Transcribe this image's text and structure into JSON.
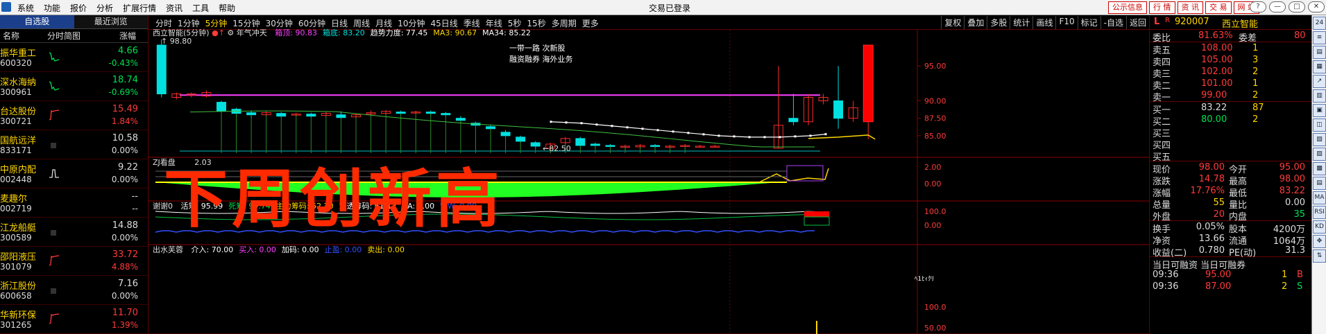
{
  "menubar": {
    "items": [
      "系统",
      "功能",
      "报价",
      "分析",
      "扩展行情",
      "资讯",
      "工具",
      "帮助"
    ],
    "title": "交易已登录",
    "right_buttons": [
      "公示信息",
      "行 情",
      "资 讯",
      "交 易",
      "网 站"
    ],
    "window_controls": [
      "?",
      "—",
      "□",
      "✕"
    ]
  },
  "watchlist": {
    "tabs": [
      "自选股",
      "最近浏览"
    ],
    "headers": [
      "名称",
      "分时简图",
      "涨幅"
    ],
    "rows": [
      {
        "name": "振华重工",
        "code": "600320",
        "price": "4.66",
        "pct": "-0.43%",
        "dir": "dn"
      },
      {
        "name": "深水海纳",
        "code": "300961",
        "price": "18.74",
        "pct": "-0.69%",
        "dir": "dn"
      },
      {
        "name": "台达股份",
        "code": "300721",
        "price": "15.49",
        "pct": "1.84%",
        "dir": "up"
      },
      {
        "name": "国航远洋",
        "code": "833171",
        "price": "10.58",
        "pct": "0.00%",
        "dir": "eq"
      },
      {
        "name": "中原内配",
        "code": "002448",
        "price": "9.22",
        "pct": "0.00%",
        "dir": "eq"
      },
      {
        "name": "麦趣尔",
        "code": "002719",
        "price": "--",
        "pct": "--",
        "dir": "eq"
      },
      {
        "name": "江龙船艇",
        "code": "300589",
        "price": "14.88",
        "pct": "0.00%",
        "dir": "eq"
      },
      {
        "name": "邵阳液压",
        "code": "301079",
        "price": "33.72",
        "pct": "4.88%",
        "dir": "up"
      },
      {
        "name": "浙江股份",
        "code": "600658",
        "price": "7.16",
        "pct": "0.00%",
        "dir": "eq"
      },
      {
        "name": "华新环保",
        "code": "301265",
        "price": "11.70",
        "pct": "1.39%",
        "dir": "up"
      }
    ]
  },
  "toolbar": {
    "periods": [
      "分时",
      "1分钟",
      "5分钟",
      "15分钟",
      "30分钟",
      "60分钟",
      "日线",
      "周线",
      "月线",
      "10分钟",
      "45日线",
      "季线",
      "年线",
      "5秒",
      "15秒",
      "多周期",
      "更多"
    ],
    "selected_period": "5分钟",
    "tools": [
      "复权",
      "叠加",
      "多股",
      "统计",
      "画线",
      "F10",
      "标记",
      "-自选",
      "返回"
    ]
  },
  "main_chart": {
    "header": "西立智能(5分钟)",
    "indicator_name": "年气冲天",
    "items": [
      {
        "label": "箱顶: 90.83",
        "color": "#ff40ff"
      },
      {
        "label": "箱底: 83.20",
        "color": "#00e0e0"
      },
      {
        "label": "趋势力度: 77.45",
        "color": "#ffffff"
      },
      {
        "label": "MA3: 90.67",
        "color": "#ffd700"
      },
      {
        "label": "MA34: 85.22",
        "color": "#ffffff"
      }
    ],
    "top_price": "98.80",
    "low_price": "82.50",
    "info_lines": [
      "一带一路 次新股",
      "融资融券 海外业务"
    ],
    "y_ticks": [
      "95.00",
      "90.00",
      "87.50",
      "85.00"
    ],
    "overlay_text": "下周创新高"
  },
  "sub1": {
    "name": "ZJ看盘",
    "items": [
      "2.03"
    ],
    "y_ticks": [
      "2.00",
      "0.00"
    ]
  },
  "sub2": {
    "name": "谢谢0",
    "items": [
      {
        "label": "活筹: 95.99",
        "color": "#ffffff"
      },
      {
        "label": "死筹: 99.74",
        "color": "#00e050"
      },
      {
        "label": "主力筹码: 52.70",
        "color": "#ffd700"
      },
      {
        "label": "穿透筹码: 61.12",
        "color": "#ffffff"
      },
      {
        "label": "AA: 1.00",
        "color": "#ffffff"
      },
      {
        "label": "WW: 0.00",
        "color": "#3050ff"
      }
    ],
    "y_ticks": [
      "100.0",
      "0.00"
    ]
  },
  "sub3": {
    "name": "出水芙蓉",
    "items": [
      {
        "label": "介入: 70.00",
        "color": "#ffffff"
      },
      {
        "label": "买入: 0.00",
        "color": "#ff40ff"
      },
      {
        "label": "加码: 0.00",
        "color": "#ffffff"
      },
      {
        "label": "止盈: 0.00",
        "color": "#3050ff"
      },
      {
        "label": "卖出: 0.00",
        "color": "#ffd700"
      }
    ],
    "mark": "ﾍ1ﾋｨｸﾘ",
    "y_ticks": [
      "100.0",
      "50.00"
    ]
  },
  "quote": {
    "code": "920007",
    "name": "西立智能",
    "tag": "L",
    "webi": [
      "委比",
      "81.63%",
      "委差",
      "80"
    ],
    "asks": [
      {
        "label": "卖五",
        "price": "108.00",
        "vol": "1"
      },
      {
        "label": "卖四",
        "price": "105.00",
        "vol": "3"
      },
      {
        "label": "卖三",
        "price": "102.00",
        "vol": "2"
      },
      {
        "label": "卖二",
        "price": "101.00",
        "vol": "1"
      },
      {
        "label": "卖一",
        "price": "99.00",
        "vol": "2"
      }
    ],
    "bids": [
      {
        "label": "买一",
        "price": "83.22",
        "vol": "87"
      },
      {
        "label": "买二",
        "price": "80.00",
        "vol": "2"
      },
      {
        "label": "买三",
        "price": "",
        "vol": ""
      },
      {
        "label": "买四",
        "price": "",
        "vol": ""
      },
      {
        "label": "买五",
        "price": "",
        "vol": ""
      }
    ],
    "stats": [
      [
        "现价",
        "98.00",
        "今开",
        "95.00"
      ],
      [
        "涨跌",
        "14.78",
        "最高",
        "98.00"
      ],
      [
        "涨幅",
        "17.76%",
        "最低",
        "83.22"
      ],
      [
        "总量",
        "55",
        "量比",
        "0.00"
      ],
      [
        "外盘",
        "20",
        "内盘",
        "35"
      ]
    ],
    "stats2": [
      [
        "换手",
        "0.05%",
        "股本",
        "4200万"
      ],
      [
        "净资",
        "13.66",
        "流通",
        "1064万"
      ],
      [
        "收益(二)",
        "0.780",
        "PE(动)",
        "31.3"
      ]
    ],
    "margin_header": "当日可融资 当日可融券",
    "ticks": [
      {
        "time": "09:36",
        "price": "95.00",
        "vol": "1",
        "side": "B"
      },
      {
        "time": "09:36",
        "price": "87.00",
        "vol": "2",
        "side": "S"
      }
    ]
  },
  "iconbar": [
    "24",
    "≡",
    "▤",
    "▦",
    "↗",
    "▥",
    "▣",
    "◫",
    "▧",
    "▨",
    "▩",
    "▤",
    "MA",
    "RSI",
    "KD",
    "✥",
    "⇅"
  ],
  "chart_data": {
    "type": "candlestick",
    "title": "西立智能(5分钟)",
    "candles_approx": [
      {
        "o": 98.0,
        "c": 91.0,
        "h": 98.8,
        "l": 90.5
      },
      {
        "o": 90.5,
        "c": 91.0,
        "h": 91.2,
        "l": 90.2
      },
      {
        "o": 90.8,
        "c": 91.0,
        "h": 91.2,
        "l": 90.5
      },
      {
        "o": 90.7,
        "c": 91.2,
        "h": 91.5,
        "l": 90.5
      },
      {
        "o": 89.8,
        "c": 88.5,
        "h": 90.0,
        "l": 88.0
      },
      {
        "o": 88.8,
        "c": 88.2,
        "h": 89.0,
        "l": 87.8
      },
      {
        "o": 88.3,
        "c": 88.0,
        "h": 88.6,
        "l": 87.5
      },
      {
        "o": 88.0,
        "c": 88.3,
        "h": 88.5,
        "l": 87.8
      },
      {
        "o": 88.2,
        "c": 87.8,
        "h": 88.4,
        "l": 87.6
      },
      {
        "o": 88.0,
        "c": 88.1,
        "h": 88.3,
        "l": 87.8
      },
      {
        "o": 88.1,
        "c": 87.8,
        "h": 88.3,
        "l": 87.6
      },
      {
        "o": 87.9,
        "c": 88.2,
        "h": 88.5,
        "l": 87.7
      },
      {
        "o": 88.0,
        "c": 87.6,
        "h": 88.5,
        "l": 87.4
      },
      {
        "o": 87.7,
        "c": 88.0,
        "h": 88.2,
        "l": 87.5
      },
      {
        "o": 88.1,
        "c": 88.3,
        "h": 88.6,
        "l": 87.9
      },
      {
        "o": 88.2,
        "c": 88.5,
        "h": 88.7,
        "l": 88.0
      },
      {
        "o": 88.4,
        "c": 88.2,
        "h": 88.6,
        "l": 88.0
      },
      {
        "o": 88.3,
        "c": 88.4,
        "h": 88.6,
        "l": 88.1
      },
      {
        "o": 88.4,
        "c": 88.2,
        "h": 88.6,
        "l": 88.0
      },
      {
        "o": 88.2,
        "c": 88.0,
        "h": 88.4,
        "l": 87.8
      },
      {
        "o": 87.5,
        "c": 87.2,
        "h": 87.8,
        "l": 87.0
      },
      {
        "o": 86.8,
        "c": 86.5,
        "h": 87.0,
        "l": 86.3
      },
      {
        "o": 86.3,
        "c": 86.0,
        "h": 86.5,
        "l": 85.8
      },
      {
        "o": 85.5,
        "c": 85.0,
        "h": 85.8,
        "l": 84.8
      },
      {
        "o": 84.8,
        "c": 84.2,
        "h": 85.0,
        "l": 84.0
      },
      {
        "o": 84.0,
        "c": 83.5,
        "h": 84.2,
        "l": 83.2
      },
      {
        "o": 83.2,
        "c": 83.8,
        "h": 84.0,
        "l": 82.5
      },
      {
        "o": 84.0,
        "c": 84.6,
        "h": 84.8,
        "l": 83.8
      },
      {
        "o": 84.6,
        "c": 83.6,
        "h": 84.8,
        "l": 83.5
      },
      {
        "o": 83.8,
        "c": 83.6,
        "h": 84.0,
        "l": 83.4
      },
      {
        "o": 83.6,
        "c": 83.5,
        "h": 83.8,
        "l": 83.3
      },
      {
        "o": 83.5,
        "c": 83.5,
        "h": 83.7,
        "l": 83.3
      },
      {
        "o": 83.4,
        "c": 83.6,
        "h": 83.8,
        "l": 83.2
      },
      {
        "o": 83.6,
        "c": 83.5,
        "h": 83.8,
        "l": 83.3
      },
      {
        "o": 83.5,
        "c": 83.5,
        "h": 83.7,
        "l": 83.3
      },
      {
        "o": 83.5,
        "c": 83.6,
        "h": 83.8,
        "l": 83.4
      },
      {
        "o": 83.5,
        "c": 83.5,
        "h": 83.7,
        "l": 83.3
      },
      {
        "o": 83.5,
        "c": 83.5,
        "h": 83.7,
        "l": 83.3
      },
      {
        "o": 83.2,
        "c": 86.5,
        "h": 95.0,
        "l": 83.2
      },
      {
        "o": 87.5,
        "c": 87.0,
        "h": 91.0,
        "l": 86.5
      },
      {
        "o": 87.0,
        "c": 90.5,
        "h": 91.0,
        "l": 86.5
      },
      {
        "o": 90.0,
        "c": 90.5,
        "h": 91.0,
        "l": 89.5
      },
      {
        "o": 90.0,
        "c": 87.5,
        "h": 95.0,
        "l": 86.0
      },
      {
        "o": 87.5,
        "c": 89.0,
        "h": 90.0,
        "l": 87.0
      },
      {
        "o": 87.0,
        "c": 98.0,
        "h": 98.0,
        "l": 84.5
      }
    ],
    "y_range": [
      82.5,
      98.8
    ],
    "box_top": 90.83,
    "box_bottom": 83.2,
    "ma_white_approx": [
      87.0,
      86.9,
      86.8,
      86.6,
      86.4,
      86.2,
      86.0,
      85.8,
      85.6,
      85.4,
      85.2,
      85.0,
      84.9,
      84.8,
      84.8,
      84.8,
      84.9,
      85.0,
      85.22
    ]
  }
}
